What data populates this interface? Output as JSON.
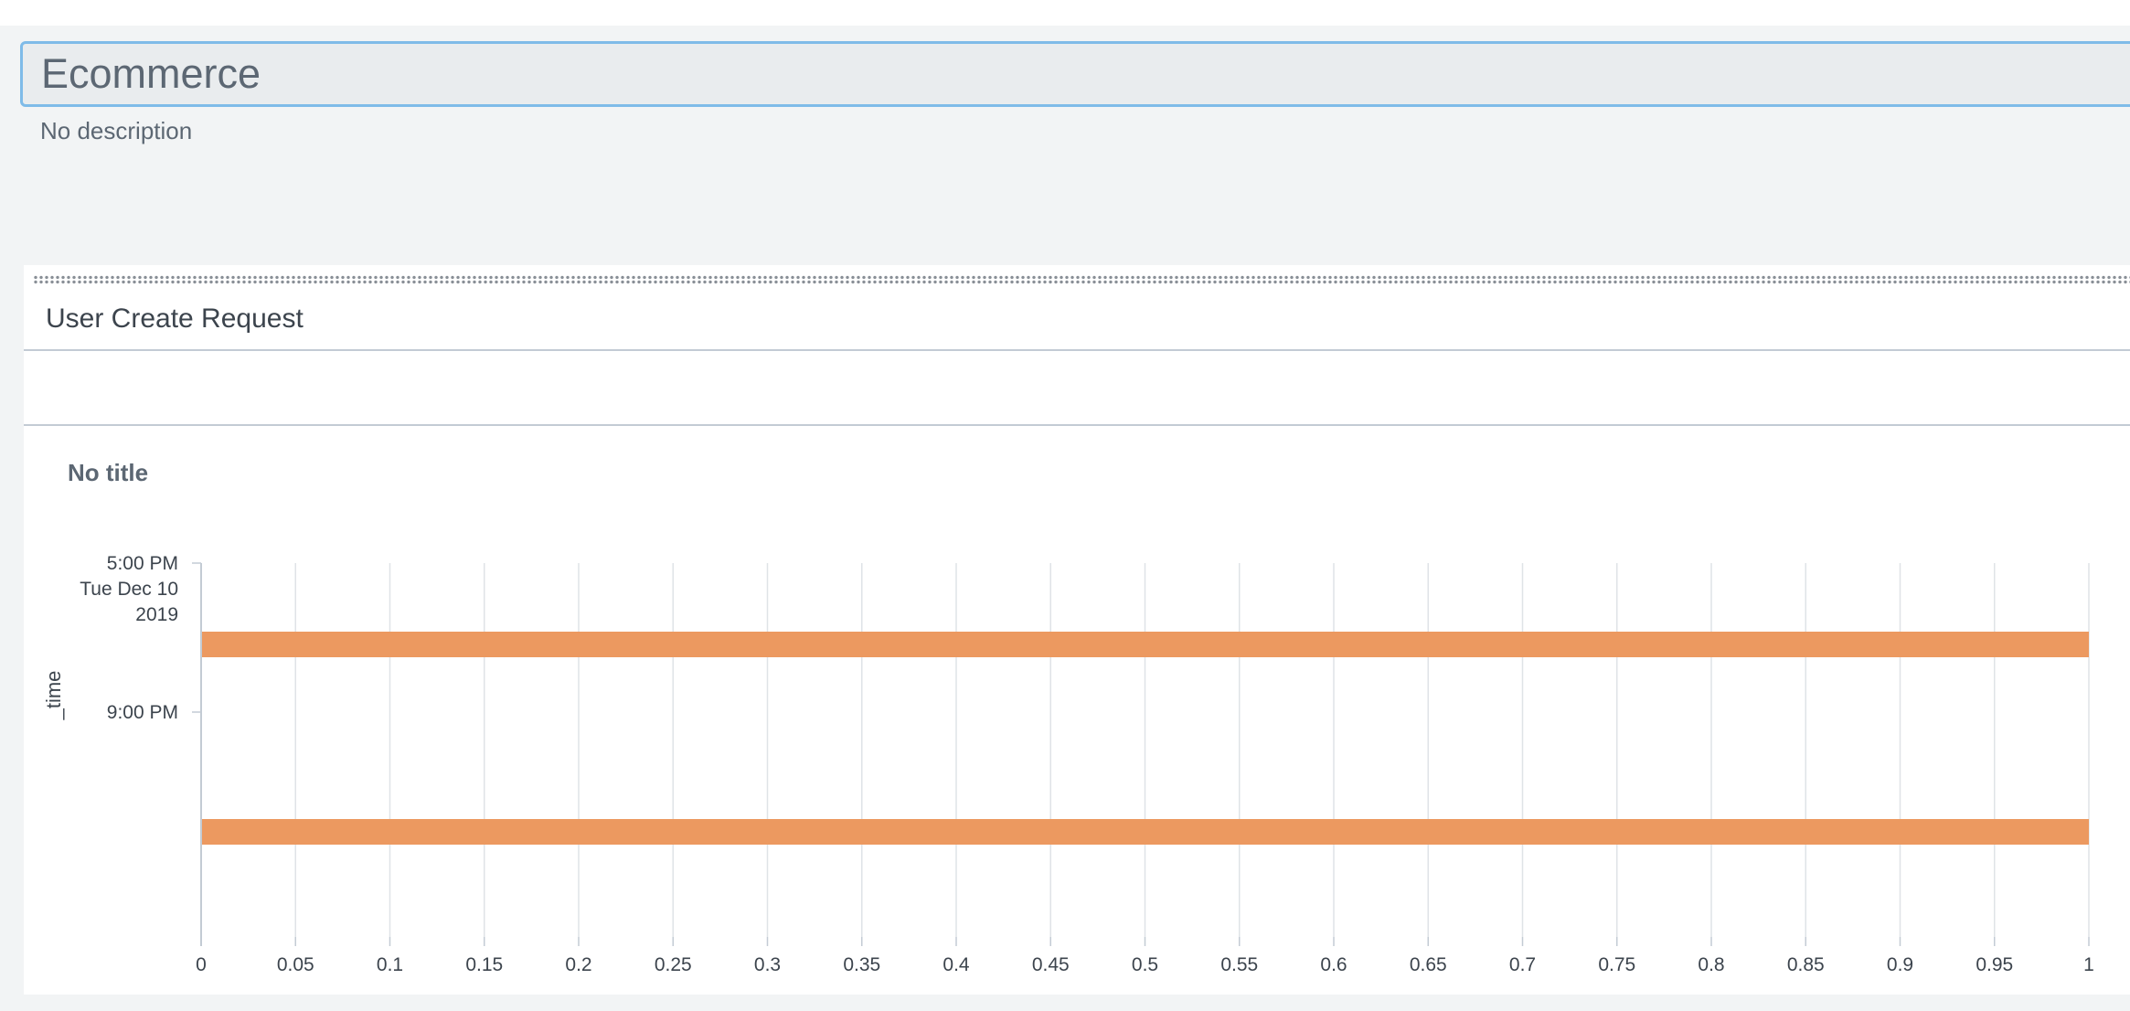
{
  "dashboard": {
    "title": "Ecommerce",
    "description": "No description"
  },
  "panel": {
    "title": "User Create Request",
    "viz_title": "No title"
  },
  "colors": {
    "bar": "#ec9960",
    "accent_border": "#7fbbe8"
  },
  "chart_data": {
    "type": "bar",
    "orientation": "horizontal",
    "title": "No title",
    "ylabel": "_time",
    "xlabel": "",
    "categories": [
      "5:00 PM Tue Dec 10 2019",
      "9:00 PM"
    ],
    "y_tick_labels": [
      [
        "5:00 PM",
        "Tue Dec 10",
        "2019"
      ],
      [
        "9:00 PM"
      ]
    ],
    "values": [
      1,
      1
    ],
    "xlim": [
      0,
      1
    ],
    "x_ticks": [
      "0",
      "0.05",
      "0.1",
      "0.15",
      "0.2",
      "0.25",
      "0.3",
      "0.35",
      "0.4",
      "0.45",
      "0.5",
      "0.55",
      "0.6",
      "0.65",
      "0.7",
      "0.75",
      "0.8",
      "0.85",
      "0.9",
      "0.95",
      "1"
    ],
    "grid": "vertical",
    "legend": "none"
  }
}
